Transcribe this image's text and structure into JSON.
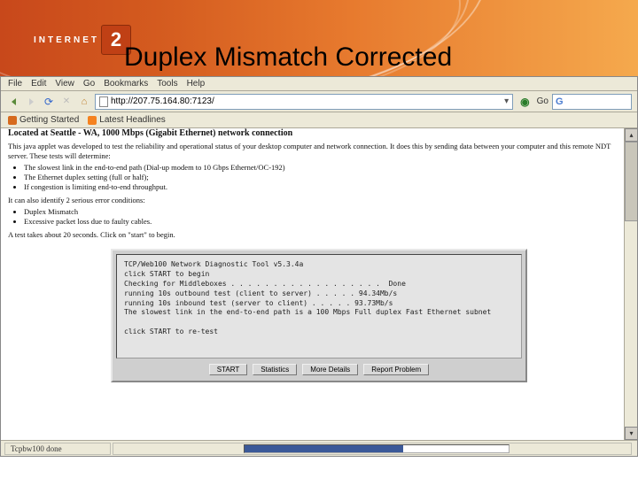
{
  "logo": {
    "left": "INTERNET",
    "two": "2"
  },
  "slide": {
    "title": "Duplex Mismatch Corrected"
  },
  "menus": {
    "file": "File",
    "edit": "Edit",
    "view": "View",
    "go": "Go",
    "bookmarks": "Bookmarks",
    "tools": "Tools",
    "help": "Help"
  },
  "address": {
    "url": "http://207.75.164.80:7123/"
  },
  "toolbar": {
    "go": "Go"
  },
  "bookmarks_bar": {
    "getting_started": "Getting Started",
    "latest_headlines": "Latest Headlines"
  },
  "page": {
    "located": "Located at Seattle - WA, 1000 Mbps (Gigabit Ethernet) network connection",
    "intro": "This java applet was developed to test the reliability and operational status of your desktop computer and network connection. It does this by sending data between your computer and this remote NDT server. These tests will determine:",
    "bullets_a": [
      "The slowest link in the end-to-end path (Dial-up modem to 10 Gbps Ethernet/OC-192)",
      "The Ethernet duplex setting (full or half);",
      "If congestion is limiting end-to-end throughput."
    ],
    "also": "It can also identify 2 serious error conditions:",
    "bullets_b": [
      "Duplex Mismatch",
      "Excessive packet loss due to faulty cables."
    ],
    "begin": "A test takes about 20 seconds. Click on \"start\" to begin."
  },
  "applet": {
    "lines": "TCP/Web100 Network Diagnostic Tool v5.3.4a\nclick START to begin\nChecking for Middleboxes . . . . . . . . . . . . . . . . . .  Done\nrunning 10s outbound test (client to server) . . . . . 94.34Mb/s\nrunning 10s inbound test (server to client) . . . . . 93.73Mb/s\nThe slowest link in the end-to-end path is a 100 Mbps Full duplex Fast Ethernet subnet\n\nclick START to re-test",
    "buttons": {
      "start": "START",
      "statistics": "Statistics",
      "more_details": "More Details",
      "report_problem": "Report Problem"
    }
  },
  "status": {
    "left": "Tcpbw100 done"
  }
}
